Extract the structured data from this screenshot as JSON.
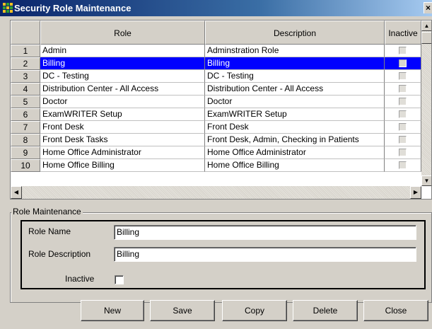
{
  "window": {
    "title": "Security Role Maintenance",
    "close_glyph": "×"
  },
  "grid": {
    "headers": [
      "",
      "Role",
      "Description",
      "Inactive"
    ],
    "rows": [
      {
        "num": "1",
        "role": "Admin",
        "description": "Adminstration Role",
        "inactive": false,
        "selected": false
      },
      {
        "num": "2",
        "role": "Billing",
        "description": "Billing",
        "inactive": false,
        "selected": true
      },
      {
        "num": "3",
        "role": "DC - Testing",
        "description": "DC - Testing",
        "inactive": false,
        "selected": false
      },
      {
        "num": "4",
        "role": "Distribution Center - All Access",
        "description": "Distribution Center - All Access",
        "inactive": false,
        "selected": false
      },
      {
        "num": "5",
        "role": "Doctor",
        "description": "Doctor",
        "inactive": false,
        "selected": false
      },
      {
        "num": "6",
        "role": "ExamWRITER Setup",
        "description": "ExamWRITER Setup",
        "inactive": false,
        "selected": false
      },
      {
        "num": "7",
        "role": "Front Desk",
        "description": "Front Desk",
        "inactive": false,
        "selected": false
      },
      {
        "num": "8",
        "role": "Front Desk Tasks",
        "description": "Front Desk, Admin, Checking in Patients",
        "inactive": false,
        "selected": false
      },
      {
        "num": "9",
        "role": "Home Office Administrator",
        "description": "Home Office Administrator",
        "inactive": false,
        "selected": false
      },
      {
        "num": "10",
        "role": "Home Office Billing",
        "description": "Home Office Billing",
        "inactive": false,
        "selected": false
      }
    ]
  },
  "form": {
    "group_label": "Role Maintenance",
    "role_name_label": "Role Name",
    "role_name_value": "Billing",
    "role_description_label": "Role Description",
    "role_description_value": "Billing",
    "inactive_label": "Inactive",
    "inactive_checked": false
  },
  "buttons": {
    "new": "New",
    "save": "Save",
    "copy": "Copy",
    "delete": "Delete",
    "close": "Close"
  },
  "colors": {
    "selection": "#0000ff",
    "title_bar": "#0a246a",
    "window_bg": "#d4d0c8"
  },
  "icons": {
    "app": "app-icon",
    "close": "close-icon"
  }
}
